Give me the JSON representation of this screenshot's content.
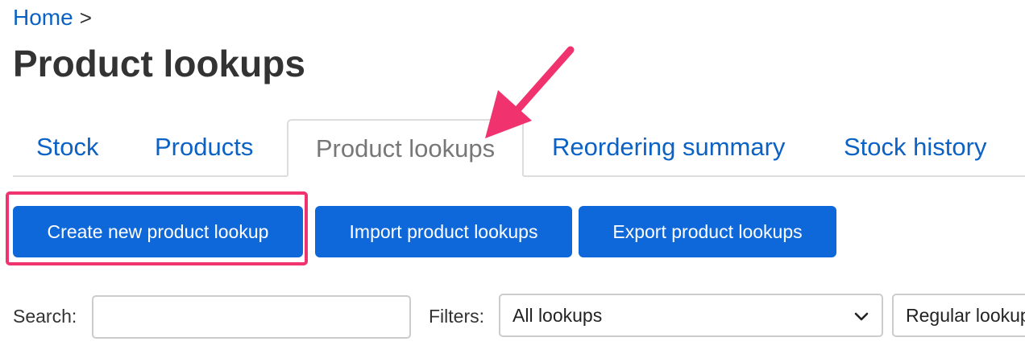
{
  "breadcrumb": {
    "home_label": "Home",
    "separator": ">"
  },
  "page": {
    "title": "Product lookups"
  },
  "tabs": [
    {
      "label": "Stock",
      "active": false
    },
    {
      "label": "Products",
      "active": false
    },
    {
      "label": "Product lookups",
      "active": true
    },
    {
      "label": "Reordering summary",
      "active": false
    },
    {
      "label": "Stock history",
      "active": false
    }
  ],
  "actions": {
    "create_label": "Create new product lookup",
    "import_label": "Import product lookups",
    "export_label": "Export product lookups"
  },
  "search": {
    "label": "Search:",
    "value": "",
    "placeholder": ""
  },
  "filters": {
    "label": "Filters:",
    "lookup_filter": "All lookups",
    "type_filter": "Regular lookups"
  },
  "colors": {
    "link": "#0b62c4",
    "button": "#0f68d9",
    "annotation": "#f0336e"
  },
  "icons": {
    "dropdown": "chevron-down-icon",
    "annotation_arrow": "arrow-icon"
  }
}
